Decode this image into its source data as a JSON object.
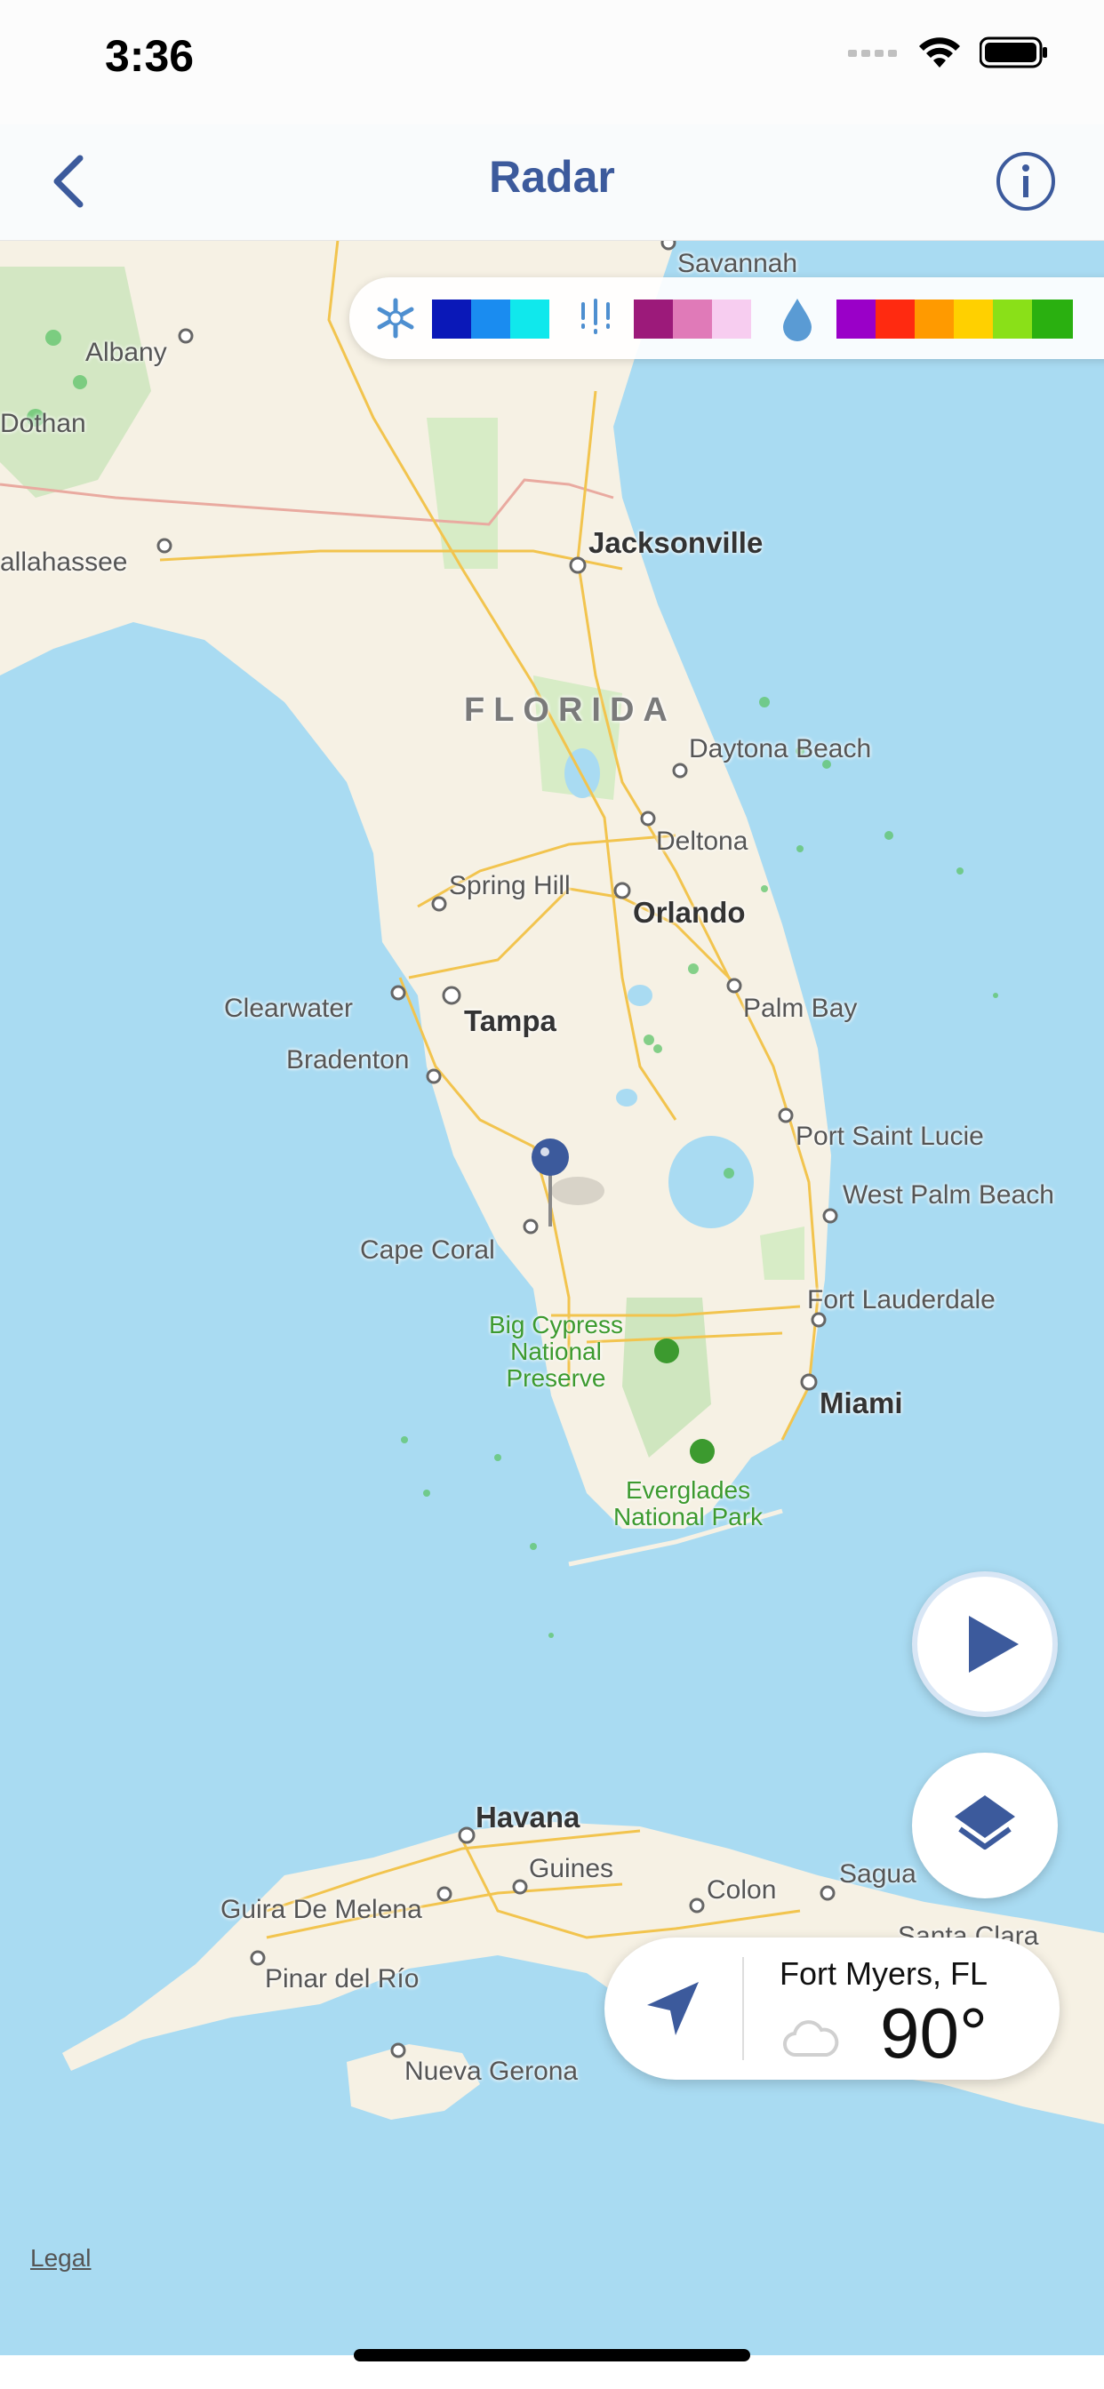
{
  "status_bar": {
    "time": "3:36"
  },
  "nav": {
    "title": "Radar"
  },
  "legend": {
    "snow_colors": [
      "#0a18b8",
      "#1a8cf0",
      "#10e8ec"
    ],
    "mix_colors": [
      "#9c1a7a",
      "#e07ab8",
      "#f7cdf0"
    ],
    "rain_colors": [
      "#9a00c8",
      "#ff2a10",
      "#ff9a00",
      "#ffd000",
      "#8ae018",
      "#2ab010"
    ]
  },
  "map": {
    "labels": {
      "savannah": "Savannah",
      "albany": "Albany",
      "dothan": "Dothan",
      "tallahassee": "allahassee",
      "jacksonville": "Jacksonville",
      "florida": "FLORIDA",
      "daytona": "Daytona Beach",
      "deltona": "Deltona",
      "spring_hill": "Spring Hill",
      "orlando": "Orlando",
      "clearwater": "Clearwater",
      "tampa": "Tampa",
      "palm_bay": "Palm Bay",
      "bradenton": "Bradenton",
      "port_st_lucie": "Port Saint Lucie",
      "west_palm": "West Palm Beach",
      "cape_coral": "Cape Coral",
      "big_cypress": "Big Cypress\nNational\nPreserve",
      "fort_lauderdale": "Fort Lauderdale",
      "miami": "Miami",
      "everglades": "Everglades\nNational Park",
      "havana": "Havana",
      "guines": "Guines",
      "guira": "Guira De Melena",
      "colon": "Colon",
      "sagua": "Sagua",
      "pinar": "Pinar del Río",
      "nueva_gerona": "Nueva Gerona",
      "santa_clara": "Santa Clara"
    },
    "legal": "Legal"
  },
  "location_card": {
    "name": "Fort Myers, FL",
    "temp": "90°",
    "condition_icon": "cloud-icon"
  }
}
